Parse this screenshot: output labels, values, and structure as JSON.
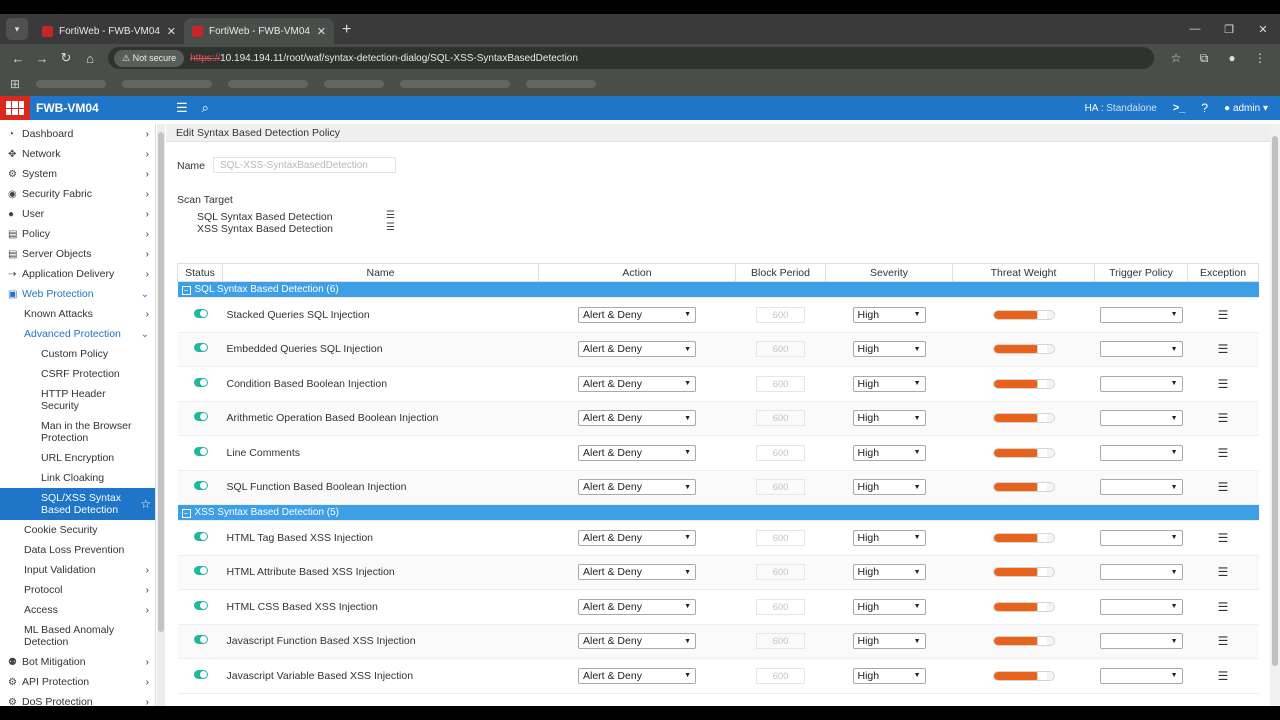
{
  "browser": {
    "tabs": [
      {
        "title": "FortiWeb - FWB-VM04",
        "active": false
      },
      {
        "title": "FortiWeb - FWB-VM04",
        "active": true
      }
    ],
    "not_secure": "Not secure",
    "url_scheme": "https://",
    "url_rest": "10.194.194.11/root/waf/syntax-detection-dialog/SQL-XSS-SyntaxBasedDetection"
  },
  "app": {
    "hostname": "FWB-VM04",
    "ha_label": "HA :",
    "ha_value": "Standalone",
    "user": "admin"
  },
  "sidebar": {
    "items": [
      {
        "label": "Dashboard",
        "icon": "dashboard-icon",
        "glyph": "◔"
      },
      {
        "label": "Network",
        "icon": "network-icon",
        "glyph": "✥"
      },
      {
        "label": "System",
        "icon": "system-gear-icon",
        "glyph": "⚙"
      },
      {
        "label": "Security Fabric",
        "icon": "security-fabric-icon",
        "glyph": "◉"
      },
      {
        "label": "User",
        "icon": "user-icon",
        "glyph": "●"
      },
      {
        "label": "Policy",
        "icon": "policy-icon",
        "glyph": "▤"
      },
      {
        "label": "Server Objects",
        "icon": "server-objects-icon",
        "glyph": "▤"
      },
      {
        "label": "Application Delivery",
        "icon": "application-delivery-icon",
        "glyph": "⇢"
      },
      {
        "label": "Web Protection",
        "icon": "lock-icon",
        "glyph": "▣"
      }
    ],
    "web_protection_children": {
      "known_attacks": "Known Attacks",
      "advanced_protection": "Advanced Protection",
      "advanced_children": [
        "Custom Policy",
        "CSRF Protection",
        "HTTP Header Security",
        "Man in the Browser Protection",
        "URL Encryption",
        "Link Cloaking",
        "SQL/XSS Syntax Based Detection"
      ],
      "others": [
        {
          "label": "Cookie Security",
          "chevron": false
        },
        {
          "label": "Data Loss Prevention",
          "chevron": false
        },
        {
          "label": "Input Validation",
          "chevron": true
        },
        {
          "label": "Protocol",
          "chevron": true
        },
        {
          "label": "Access",
          "chevron": true
        },
        {
          "label": "ML Based Anomaly Detection",
          "chevron": false
        }
      ]
    },
    "bottom_items": [
      {
        "label": "Bot Mitigation",
        "icon": "bot-icon",
        "glyph": "⚉"
      },
      {
        "label": "API Protection",
        "icon": "api-icon",
        "glyph": "⚙"
      },
      {
        "label": "DoS Protection",
        "icon": "dos-icon",
        "glyph": "⚙"
      }
    ]
  },
  "form": {
    "page_title": "Edit Syntax Based Detection Policy",
    "name_label": "Name",
    "name_value": "SQL-XSS-SyntaxBasedDetection",
    "scan_target_label": "Scan Target",
    "scan_targets": [
      "SQL Syntax Based Detection",
      "XSS Syntax Based Detection"
    ]
  },
  "table": {
    "headers": [
      "Status",
      "Name",
      "Action",
      "Block Period",
      "Severity",
      "Threat Weight",
      "Trigger Policy",
      "Exception"
    ],
    "groups": [
      {
        "title": "SQL Syntax Based Detection (6)",
        "rows": [
          {
            "name": "Stacked Queries SQL Injection",
            "action": "Alert & Deny",
            "block_period": "600",
            "severity": "High",
            "threat_weight": 0.75,
            "trigger": ""
          },
          {
            "name": "Embedded Queries SQL Injection",
            "action": "Alert & Deny",
            "block_period": "600",
            "severity": "High",
            "threat_weight": 0.75,
            "trigger": ""
          },
          {
            "name": "Condition Based Boolean Injection",
            "action": "Alert & Deny",
            "block_period": "600",
            "severity": "High",
            "threat_weight": 0.75,
            "trigger": ""
          },
          {
            "name": "Arithmetic Operation Based Boolean Injection",
            "action": "Alert & Deny",
            "block_period": "600",
            "severity": "High",
            "threat_weight": 0.75,
            "trigger": ""
          },
          {
            "name": "Line Comments",
            "action": "Alert & Deny",
            "block_period": "600",
            "severity": "High",
            "threat_weight": 0.75,
            "trigger": ""
          },
          {
            "name": "SQL Function Based Boolean Injection",
            "action": "Alert & Deny",
            "block_period": "600",
            "severity": "High",
            "threat_weight": 0.75,
            "trigger": ""
          }
        ]
      },
      {
        "title": "XSS Syntax Based Detection (5)",
        "rows": [
          {
            "name": "HTML Tag Based XSS Injection",
            "action": "Alert & Deny",
            "block_period": "600",
            "severity": "High",
            "threat_weight": 0.75,
            "trigger": ""
          },
          {
            "name": "HTML Attribute Based XSS Injection",
            "action": "Alert & Deny",
            "block_period": "600",
            "severity": "High",
            "threat_weight": 0.75,
            "trigger": ""
          },
          {
            "name": "HTML CSS Based XSS Injection",
            "action": "Alert & Deny",
            "block_period": "600",
            "severity": "High",
            "threat_weight": 0.75,
            "trigger": ""
          },
          {
            "name": "Javascript Function Based XSS Injection",
            "action": "Alert & Deny",
            "block_period": "600",
            "severity": "High",
            "threat_weight": 0.75,
            "trigger": ""
          },
          {
            "name": "Javascript Variable Based XSS Injection",
            "action": "Alert & Deny",
            "block_period": "600",
            "severity": "High",
            "threat_weight": 0.75,
            "trigger": ""
          }
        ]
      }
    ]
  },
  "colors": {
    "header_blue": "#1f75c7",
    "group_blue": "#3d9fe6",
    "toggle_on": "#20b7a0",
    "threat_orange": "#e8621c",
    "logo_red": "#da291c"
  }
}
